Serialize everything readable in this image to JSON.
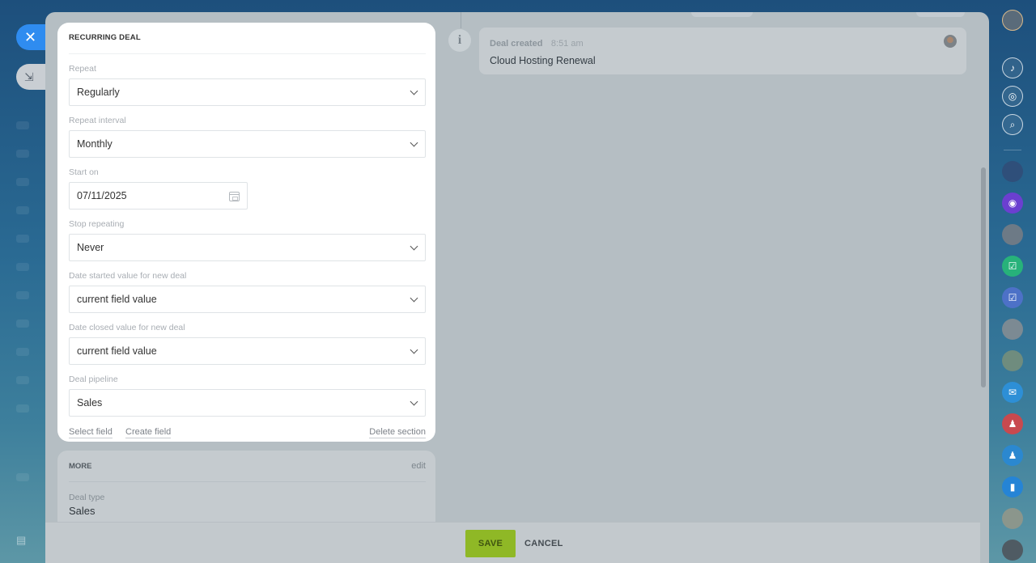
{
  "recurring_deal": {
    "title": "RECURRING DEAL",
    "fields": [
      {
        "label": "Repeat",
        "value": "Regularly"
      },
      {
        "label": "Repeat interval",
        "value": "Monthly"
      },
      {
        "label": "Start on",
        "value": "07/11/2025"
      },
      {
        "label": "Stop repeating",
        "value": "Never"
      },
      {
        "label": "Date started value for new deal",
        "value": "current field value"
      },
      {
        "label": "Date closed value for new deal",
        "value": "current field value"
      },
      {
        "label": "Deal pipeline",
        "value": "Sales"
      }
    ],
    "footer": {
      "select_field": "Select field",
      "create_field": "Create field",
      "delete_section": "Delete section"
    }
  },
  "more": {
    "title": "MORE",
    "edit": "edit",
    "deal_type_label": "Deal type",
    "deal_type_value": "Sales"
  },
  "timeline": {
    "event_title": "Deal created",
    "event_time": "8:51 am",
    "event_body": "Cloud Hosting Renewal"
  },
  "buttons": {
    "save": "SAVE",
    "cancel": "CANCEL",
    "close": "✕"
  },
  "right_sidebar": {
    "items": [
      {
        "name": "user-avatar",
        "color": "#5a6b7a"
      },
      {
        "name": "bell-icon",
        "color": "outline"
      },
      {
        "name": "target-icon",
        "color": "outline"
      },
      {
        "name": "chat-search-icon",
        "color": "outline"
      },
      {
        "name": "contact-avatar-1",
        "color": "#2f4f7a"
      },
      {
        "name": "copilot-icon",
        "color": "#6b3fd0"
      },
      {
        "name": "contact-avatar-2",
        "color": "#6d7a86"
      },
      {
        "name": "task-icon-green",
        "color": "#27b27a"
      },
      {
        "name": "task-icon-blue",
        "color": "#4d71c7"
      },
      {
        "name": "contact-avatar-3",
        "color": "#7c8a93"
      },
      {
        "name": "contact-avatar-4",
        "color": "#6f8c7e"
      },
      {
        "name": "mail-icon",
        "color": "#2d8fd6"
      },
      {
        "name": "group-chat-icon-red",
        "color": "#c8494f"
      },
      {
        "name": "group-chat-icon-blue",
        "color": "#2b88d0"
      },
      {
        "name": "bookmark-icon",
        "color": "#2584d6"
      },
      {
        "name": "contact-avatar-5",
        "color": "#8b968c"
      },
      {
        "name": "contact-avatar-6",
        "color": "#4f5b63"
      }
    ]
  }
}
